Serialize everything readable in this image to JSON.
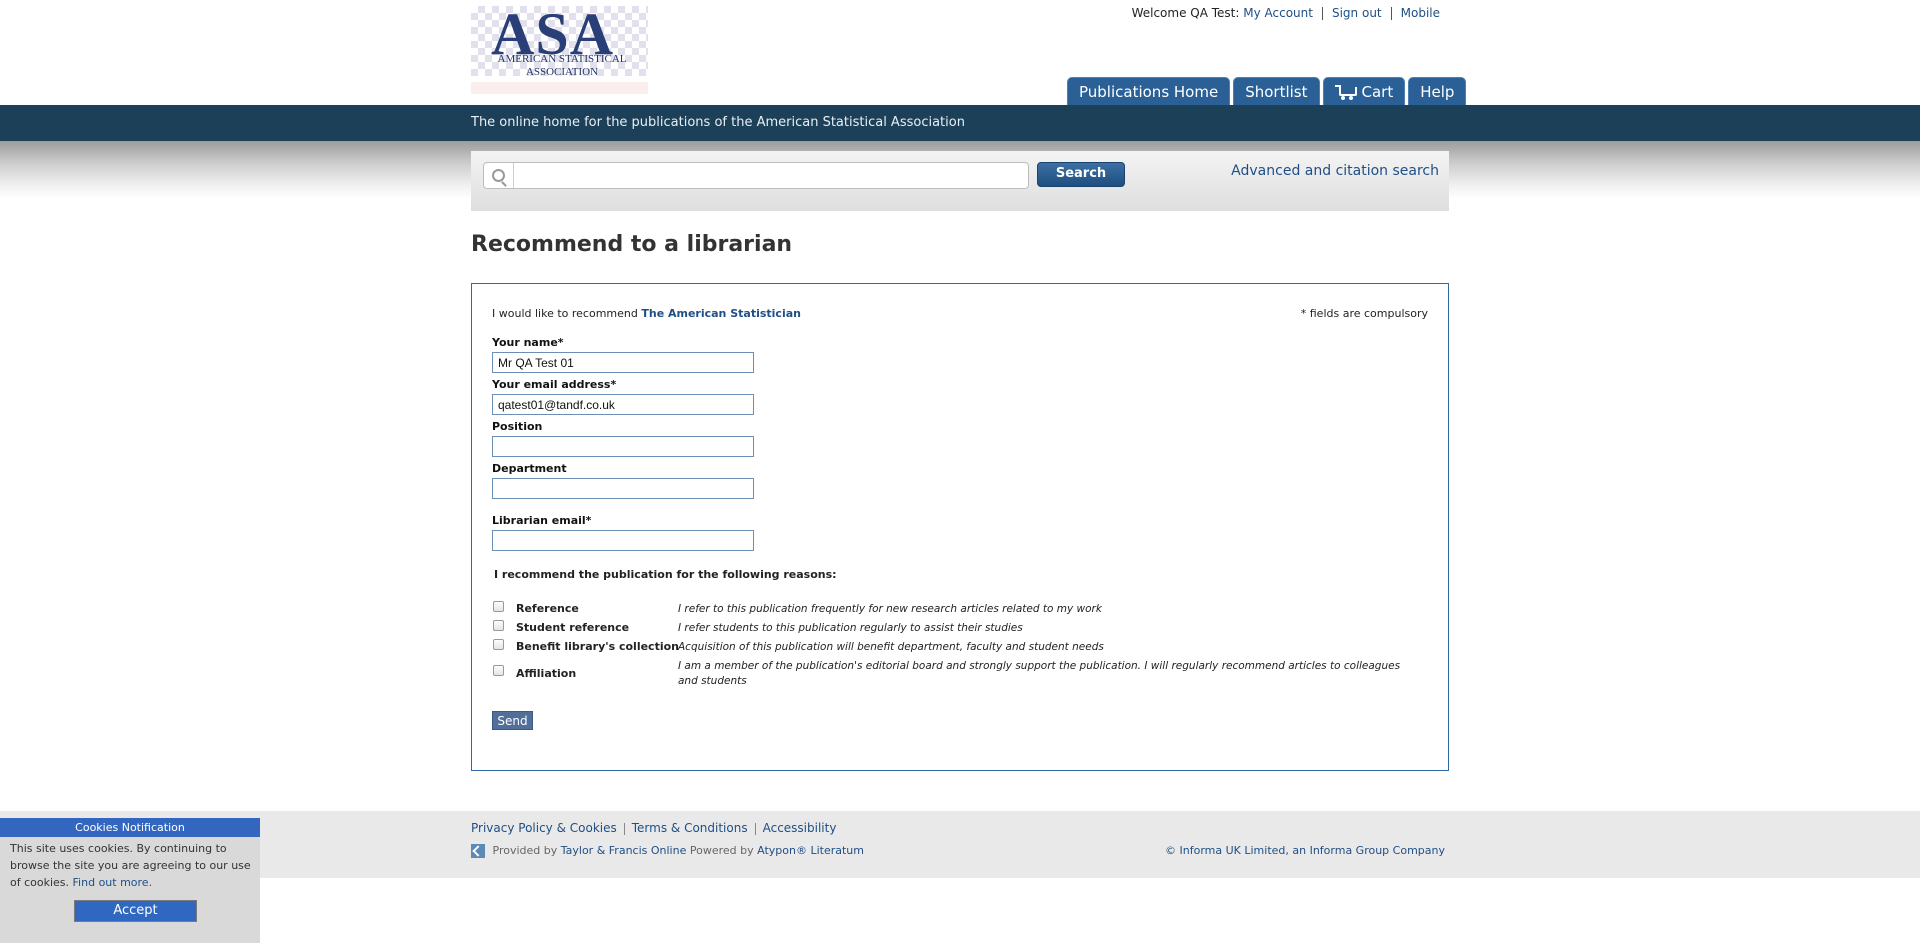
{
  "logo": {
    "abbr": "ASA",
    "line1": "AMERICAN STATISTICAL",
    "line2": "ASSOCIATION"
  },
  "header": {
    "welcome": "Welcome QA Test:",
    "my_account": "My Account",
    "sign_out": "Sign out",
    "mobile": "Mobile"
  },
  "nav": {
    "publications_home": "Publications Home",
    "shortlist": "Shortlist",
    "cart": "Cart",
    "help": "Help"
  },
  "banner": {
    "tagline": "The online home for the publications of the American Statistical Association"
  },
  "search": {
    "placeholder": "",
    "button": "Search",
    "advanced": "Advanced and citation search"
  },
  "page": {
    "title": "Recommend to a librarian"
  },
  "form": {
    "intro": "I would like to recommend",
    "publication": "The American Statistician",
    "compulsory": "* fields are compulsory",
    "name_label": "Your name*",
    "name_value": "Mr QA Test 01",
    "email_label": "Your email address*",
    "email_value": "qatest01@tandf.co.uk",
    "position_label": "Position",
    "position_value": "",
    "department_label": "Department",
    "department_value": "",
    "librarian_label": "Librarian email*",
    "librarian_value": "",
    "reasons_title": "I recommend the publication for the following reasons:",
    "reasons": [
      {
        "label": "Reference",
        "desc": "I refer to this publication frequently for new research articles related to my work"
      },
      {
        "label": "Student reference",
        "desc": "I refer students to this publication regularly to assist their studies"
      },
      {
        "label": "Benefit library's collection",
        "desc": "Acquisition of this publication will benefit department, faculty and student needs"
      },
      {
        "label": "Affiliation",
        "desc": "I am a member of the publication's editorial board and strongly support the publication. I will regularly recommend articles to colleagues and students"
      }
    ],
    "send": "Send"
  },
  "footer": {
    "privacy": "Privacy Policy & Cookies",
    "terms": "Terms & Conditions",
    "accessibility": "Accessibility",
    "provided_by": "Provided by",
    "tf_online": "Taylor & Francis Online",
    "powered_by": "Powered by",
    "literatum": "Atypon® Literatum",
    "copyright": "© Informa UK Limited, an Informa Group Company"
  },
  "cookies": {
    "title": "Cookies Notification",
    "text": "This site uses cookies. By continuing to browse the site you are agreeing to our use of cookies.",
    "find_out": "Find out more.",
    "accept": "Accept"
  },
  "colors": {
    "banner": "#1d4059",
    "nav_tab": "#2a6096",
    "link": "#1f4f86",
    "cookie_header": "#3367bf"
  }
}
